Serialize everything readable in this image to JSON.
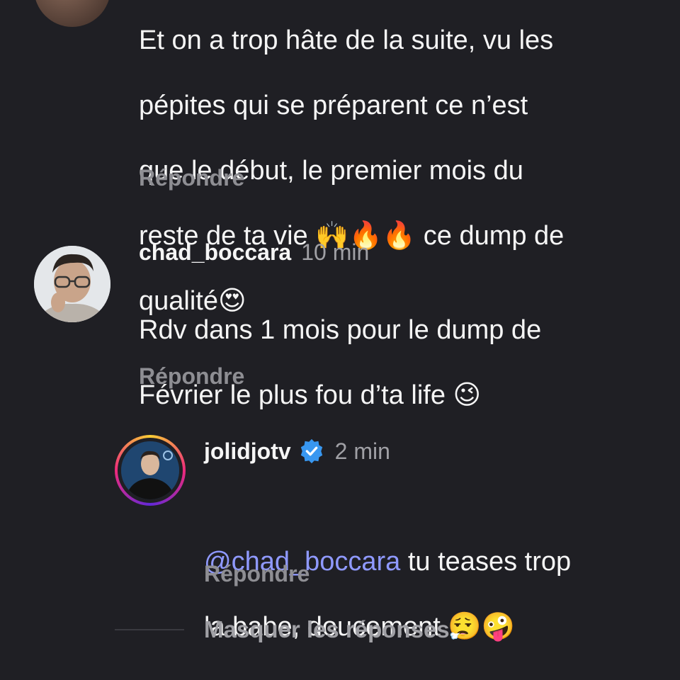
{
  "comments": [
    {
      "text_lines": [
        "Et on a trop hâte de la suite, vu les",
        "pépites qui se préparent ce n’est",
        "que le début, le premier mois du",
        "reste de ta vie 🙌🔥🔥 ce dump de",
        "qualité😍"
      ],
      "reply_label": "Répondre"
    },
    {
      "username": "chad_boccara",
      "time": "10 min",
      "text_lines": [
        "Rdv dans 1 mois pour le dump de",
        "Février le plus fou d’ta life 😉"
      ],
      "reply_label": "Répondre"
    }
  ],
  "reply": {
    "username": "jolidjotv",
    "verified": true,
    "time": "2 min",
    "mention": "@chad_boccara",
    "text_after_mention": " tu teases trop",
    "text_line2": "la babe, doucement 😮‍💨🤪",
    "reply_label": "Répondre"
  },
  "hide_replies_label": "Masquer les réponses",
  "colors": {
    "background": "#1f1f24",
    "mention": "#8f99ff",
    "verified": "#3897f0",
    "story_ring": [
      "#f9ce34",
      "#ee2a7b",
      "#6228d7"
    ]
  }
}
